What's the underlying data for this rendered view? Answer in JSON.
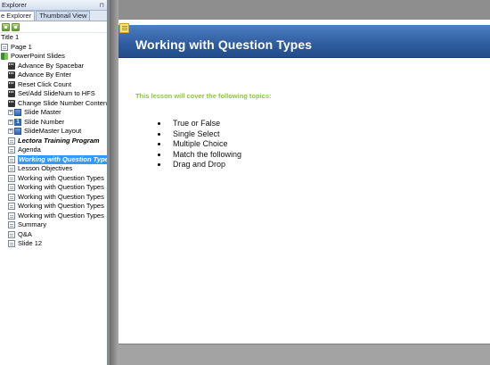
{
  "panel": {
    "title": "Explorer",
    "tabs": [
      {
        "label": "e Explorer",
        "active": true
      },
      {
        "label": "Thumbnail View",
        "active": false
      }
    ],
    "toolbar": [
      {
        "icon": "expand-all-icon"
      },
      {
        "icon": "collapse-all-icon"
      }
    ],
    "tree": [
      {
        "label": "Title 1",
        "level": 0,
        "icon": "none"
      },
      {
        "label": "Page 1",
        "level": 1,
        "icon": "page-icon"
      },
      {
        "label": "PowerPoint Slides",
        "level": 1,
        "icon": "powerpoint-icon"
      },
      {
        "label": "Advance By Spacebar",
        "level": 2,
        "icon": "action-icon"
      },
      {
        "label": "Advance By Enter",
        "level": 2,
        "icon": "action-icon"
      },
      {
        "label": "Reset Click Count",
        "level": 2,
        "icon": "action-icon"
      },
      {
        "label": "Set/Add SlideNum to HFS",
        "level": 2,
        "icon": "action-icon"
      },
      {
        "label": "Change Slide Number Contents",
        "level": 2,
        "icon": "action-icon"
      },
      {
        "label": "Slide Master",
        "level": 2,
        "icon": "slide-master-icon",
        "expander": true
      },
      {
        "label": "Slide Number",
        "level": 2,
        "icon": "slide-number-icon",
        "expander": true
      },
      {
        "label": "SlideMaster Layout",
        "level": 2,
        "icon": "slide-master-icon",
        "expander": true
      },
      {
        "label": "Lectora Training Program",
        "level": 2,
        "icon": "page-icon",
        "style": "bold-italic"
      },
      {
        "label": "Agenda",
        "level": 2,
        "icon": "page-icon"
      },
      {
        "label": "Working with Question Types",
        "level": 2,
        "icon": "page-icon",
        "selected": true
      },
      {
        "label": "Lesson Objectives",
        "level": 2,
        "icon": "page-icon"
      },
      {
        "label": "Working with Question Types",
        "level": 2,
        "icon": "page-icon"
      },
      {
        "label": "Working with Question Types",
        "level": 2,
        "icon": "page-icon"
      },
      {
        "label": "Working with Question Types",
        "level": 2,
        "icon": "page-icon"
      },
      {
        "label": "Working with Question Types",
        "level": 2,
        "icon": "page-icon"
      },
      {
        "label": "Working with Question Types",
        "level": 2,
        "icon": "page-icon"
      },
      {
        "label": "Summary",
        "level": 2,
        "icon": "page-icon"
      },
      {
        "label": "Q&A",
        "level": 2,
        "icon": "page-icon"
      },
      {
        "label": "Slide 12",
        "level": 2,
        "icon": "page-icon"
      }
    ]
  },
  "slide": {
    "title": "Working with Question Types",
    "intro": "This lesson will cover the following topics:",
    "bullets": [
      "True or False",
      "Single Select",
      "Multiple Choice",
      "Match the following",
      "Drag and Drop"
    ],
    "header_color": "#2f5c9e",
    "intro_color": "#8cc63e"
  }
}
